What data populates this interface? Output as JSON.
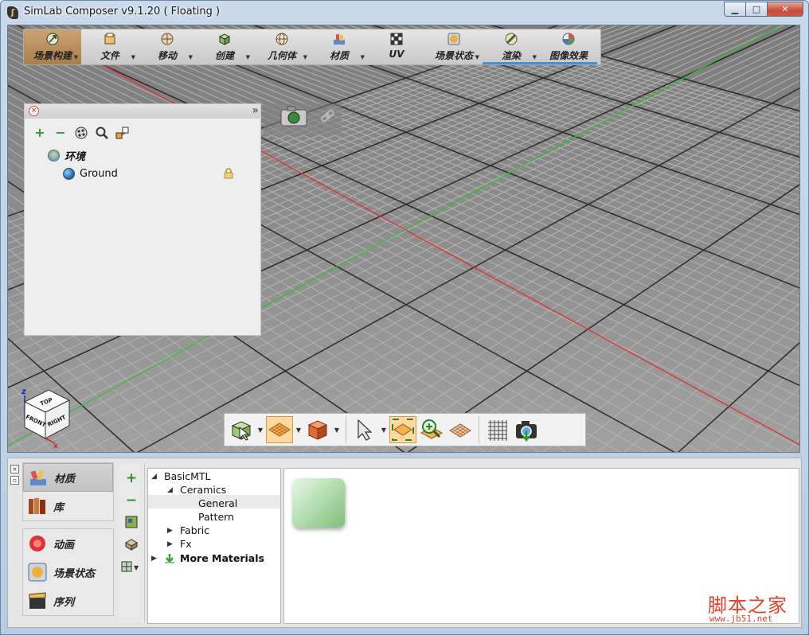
{
  "window": {
    "title": "SimLab Composer v9.1.20 ( Floating )",
    "controls": {
      "minimize": "▁",
      "maximize": "□",
      "close": "✕"
    }
  },
  "modules": [
    {
      "label": "场景构建",
      "icon": "scene-build-icon",
      "active": true,
      "dropdown": true
    },
    {
      "label": "文件",
      "icon": "file-icon",
      "dropdown": true
    },
    {
      "label": "移动",
      "icon": "move-icon",
      "dropdown": true
    },
    {
      "label": "创建",
      "icon": "create-icon",
      "dropdown": true
    },
    {
      "label": "几何体",
      "icon": "geometry-icon",
      "dropdown": true
    },
    {
      "label": "材质",
      "icon": "material-icon",
      "dropdown": true
    },
    {
      "label": "UV",
      "icon": "uv-icon",
      "dropdown": false
    },
    {
      "label": "场景状态",
      "icon": "scene-state-icon",
      "dropdown": true
    },
    {
      "label": "渲染",
      "icon": "render-icon",
      "dropdown": true
    },
    {
      "label": "图像效果",
      "icon": "image-effects-icon",
      "dropdown": false
    }
  ],
  "scene_panel": {
    "tools": [
      "+",
      "−",
      "filter",
      "search",
      "hierarchy"
    ],
    "tree": [
      {
        "label": "环境",
        "icon": "environment-icon",
        "level": 0
      },
      {
        "label": "Ground",
        "icon": "globe-icon",
        "level": 1,
        "locked": true
      }
    ]
  },
  "view_cube": {
    "top": "TOP",
    "front": "FRONT",
    "right": "RIGHT",
    "axis_z": "z",
    "axis_x": "x"
  },
  "viewport_toolbar": [
    {
      "name": "select-mode",
      "dropdown": true
    },
    {
      "name": "ground-plane",
      "dropdown": true,
      "selected": true
    },
    {
      "name": "shading",
      "dropdown": true
    },
    {
      "name": "pointer",
      "dropdown": true
    },
    {
      "name": "fit-all",
      "selected": true
    },
    {
      "name": "zoom"
    },
    {
      "name": "plane-view"
    },
    {
      "name": "grid-toggle"
    },
    {
      "name": "screenshot"
    }
  ],
  "bottom_panel": {
    "nav_top": [
      {
        "label": "材质",
        "icon": "material-brush-icon",
        "active": true
      },
      {
        "label": "库",
        "icon": "books-icon"
      }
    ],
    "nav_bottom": [
      {
        "label": "动画",
        "icon": "animation-icon"
      },
      {
        "label": "场景状态",
        "icon": "scene-state-icon"
      },
      {
        "label": "序列",
        "icon": "clapper-icon"
      }
    ],
    "material_tree": [
      {
        "label": "BasicMTL",
        "level": 0,
        "expanded": true
      },
      {
        "label": "Ceramics",
        "level": 1,
        "expanded": true
      },
      {
        "label": "General",
        "level": 2,
        "selected": true
      },
      {
        "label": "Pattern",
        "level": 2
      },
      {
        "label": "Fabric",
        "level": 1,
        "expanded": false
      },
      {
        "label": "Fx",
        "level": 1,
        "expanded": false
      },
      {
        "label": "More Materials",
        "level": 0,
        "bold": true
      }
    ],
    "preview": {
      "material": "ceramic-general-green"
    }
  },
  "watermark": {
    "main": "脚本之家",
    "url": "www.jb51.net"
  }
}
